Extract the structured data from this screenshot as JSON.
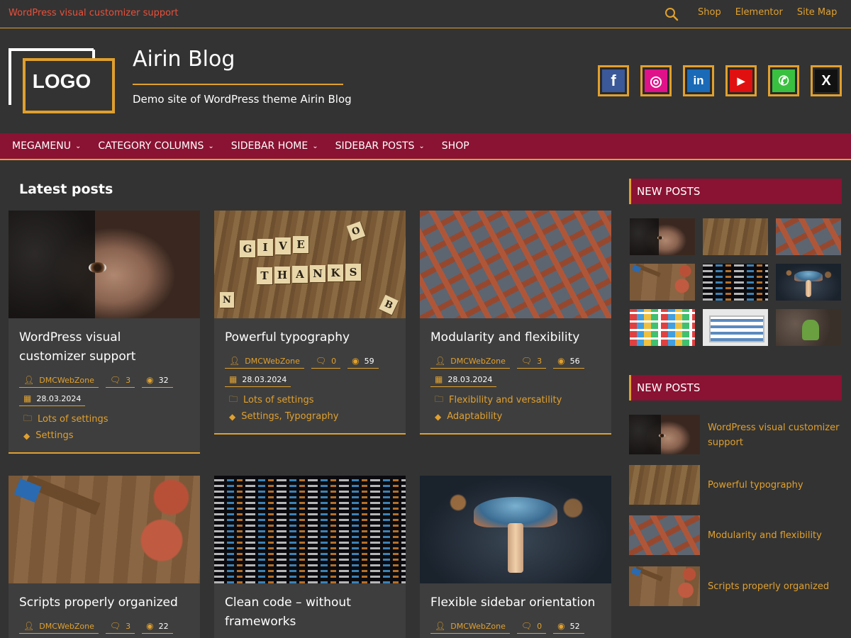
{
  "topbar": {
    "tagline": "WordPress visual customizer support",
    "links": [
      "Shop",
      "Elementor",
      "Site Map"
    ]
  },
  "header": {
    "logo_text": "LOGO",
    "site_title": "Airin Blog",
    "site_description": "Demo site of WordPress theme Airin Blog",
    "social": [
      {
        "icon": "facebook-icon",
        "glyph": "f",
        "color": "#3b5998"
      },
      {
        "icon": "instagram-icon",
        "glyph": "◎",
        "color": "#e0128a"
      },
      {
        "icon": "linkedin-icon",
        "glyph": "in",
        "color": "#1a6ab8"
      },
      {
        "icon": "youtube-icon",
        "glyph": "▶",
        "color": "#e01010"
      },
      {
        "icon": "whatsapp-icon",
        "glyph": "✆",
        "color": "#3ac040"
      },
      {
        "icon": "x-icon",
        "glyph": "X",
        "color": "#111111"
      }
    ]
  },
  "nav": {
    "items": [
      {
        "label": "MEGAMENU",
        "has_dropdown": true
      },
      {
        "label": "CATEGORY COLUMNS",
        "has_dropdown": true
      },
      {
        "label": "SIDEBAR HOME",
        "has_dropdown": true
      },
      {
        "label": "SIDEBAR POSTS",
        "has_dropdown": true
      },
      {
        "label": "SHOP",
        "has_dropdown": false
      }
    ]
  },
  "main": {
    "heading": "Latest posts",
    "posts": [
      {
        "title": "WordPress visual customizer support",
        "author": "DMCWebZone",
        "comments": "3",
        "views": "32",
        "date": "28.03.2024",
        "categories": "Lots of settings",
        "tags": "Settings",
        "image": "face"
      },
      {
        "title": "Powerful typography",
        "author": "DMCWebZone",
        "comments": "0",
        "views": "59",
        "date": "28.03.2024",
        "categories": "Lots of settings",
        "tags": "Settings, Typography",
        "image": "thanks"
      },
      {
        "title": "Modularity and flexibility",
        "author": "DMCWebZone",
        "comments": "3",
        "views": "56",
        "date": "28.03.2024",
        "categories": "Flexibility and versatility",
        "tags": "Adaptability",
        "image": "building"
      },
      {
        "title": "Scripts properly organized",
        "author": "DMCWebZone",
        "comments": "3",
        "views": "22",
        "image": "tools"
      },
      {
        "title": "Clean code – without frameworks",
        "image": "code"
      },
      {
        "title": "Flexible sidebar orientation",
        "author": "DMCWebZone",
        "comments": "0",
        "views": "52",
        "image": "mushroom"
      }
    ]
  },
  "sidebar": {
    "widget1_title": "NEW POSTS",
    "widget2_title": "NEW POSTS",
    "thumbs": [
      "face",
      "thanks",
      "building",
      "tools",
      "code",
      "mushroom",
      "apps",
      "screen",
      "android"
    ],
    "new_posts": [
      {
        "title": "WordPress visual customizer support",
        "image": "face"
      },
      {
        "title": "Powerful typography",
        "image": "thanks"
      },
      {
        "title": "Modularity and flexibility",
        "image": "building"
      },
      {
        "title": "Scripts properly organized",
        "image": "tools"
      }
    ]
  },
  "colors": {
    "background": "#333333",
    "accent": "#e0a02e",
    "nav": "#8a1232",
    "tagline": "#e8503a"
  }
}
